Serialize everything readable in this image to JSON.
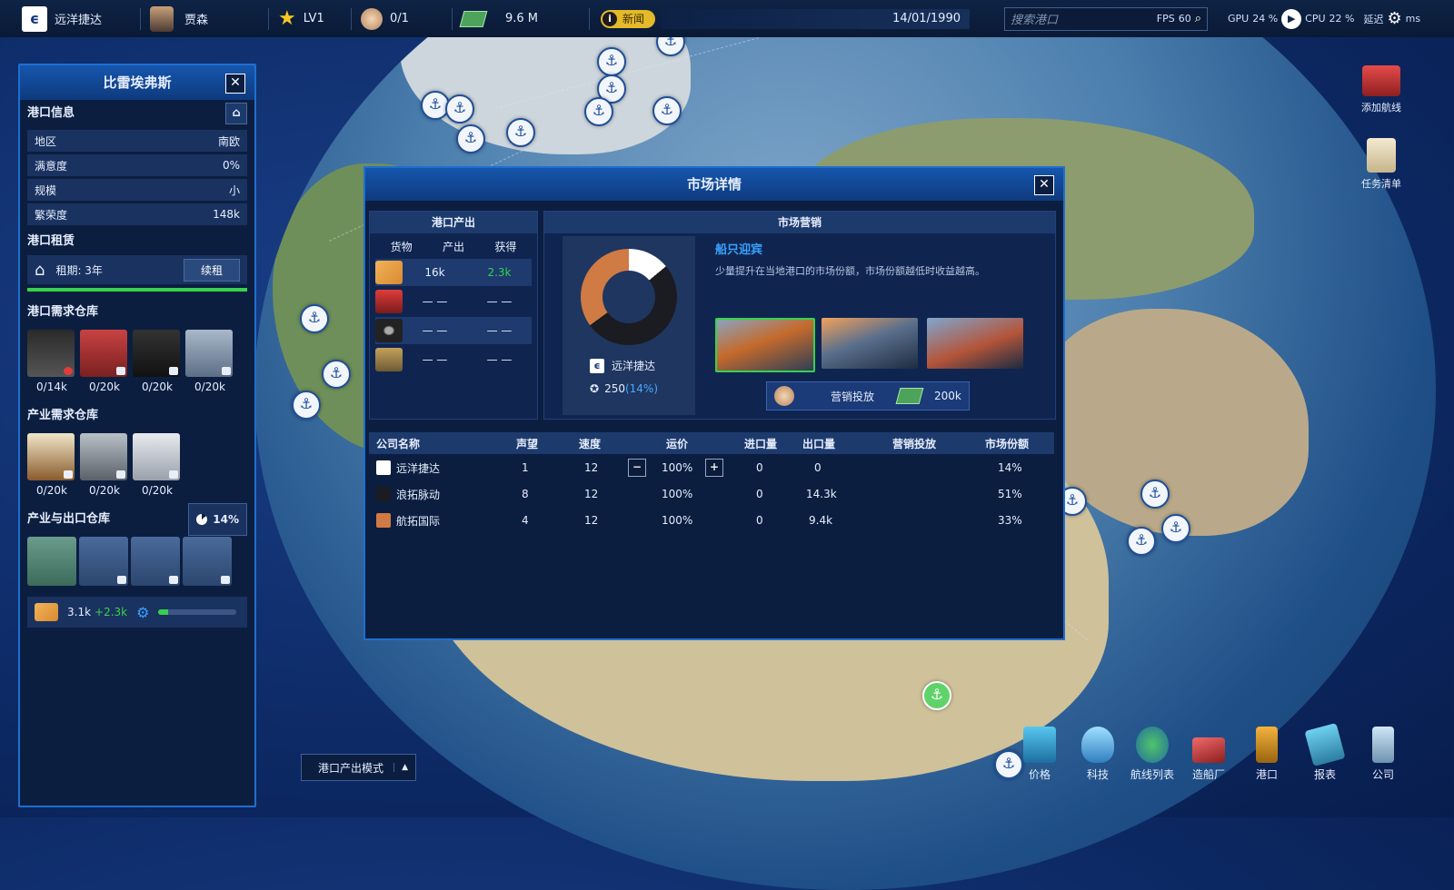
{
  "topbar": {
    "company": "远洋捷达",
    "ceo": "贾森",
    "level": "LV1",
    "staff": "0/1",
    "money": "9.6 M",
    "news": "新闻",
    "date": "14/01/1990",
    "search_placeholder": "搜索港口",
    "fps_label": "FPS",
    "fps_value": "60",
    "gpu_label": "GPU",
    "gpu_value": "24 %",
    "cpu_label": "CPU",
    "cpu_value": "22 %",
    "latency_label": "延迟",
    "latency_value": "ms"
  },
  "port_panel": {
    "title": "比雷埃弗斯",
    "info_title": "港口信息",
    "info": [
      {
        "label": "地区",
        "value": "南欧"
      },
      {
        "label": "满意度",
        "value": "0%"
      },
      {
        "label": "规模",
        "value": "小"
      },
      {
        "label": "繁荣度",
        "value": "148k"
      }
    ],
    "lease_title": "港口租赁",
    "lease_text": "租期: 3年",
    "renew_label": "续租",
    "demand_title": "港口需求仓库",
    "demand": [
      "0/14k",
      "0/20k",
      "0/20k",
      "0/20k"
    ],
    "industry_title": "产业需求仓库",
    "industry": [
      "0/20k",
      "0/20k",
      "0/20k"
    ],
    "output_title": "产业与出口仓库",
    "output_pct": "14%",
    "stock": "3.1k",
    "stock_gain": "+2.3k",
    "progress": 0.12
  },
  "market": {
    "title": "市场详情",
    "output_head": "港口产出",
    "col_goods": "货物",
    "col_output": "产出",
    "col_gain": "获得",
    "rows": [
      {
        "output": "16k",
        "gain": "2.3k"
      },
      {
        "output": "— —",
        "gain": "— —"
      },
      {
        "output": "— —",
        "gain": "— —"
      },
      {
        "output": "— —",
        "gain": "— —"
      }
    ],
    "marketing_head": "市场营销",
    "company_name": "远洋捷达",
    "score": "250",
    "score_pct": "(14%)",
    "campaign_title": "船只迎宾",
    "campaign_desc": "少量提升在当地港口的市场份额，市场份额越低时收益越高。",
    "invest_label": "营销投放",
    "invest_cost": "200k"
  },
  "table": {
    "headers": [
      "公司名称",
      "声望",
      "速度",
      "运价",
      "进口量",
      "出口量",
      "营销投放",
      "市场份额"
    ],
    "rows": [
      {
        "name": "远洋捷达",
        "rep": "1",
        "speed": "12",
        "price": "100%",
        "import": "0",
        "export": "0",
        "share": "14%",
        "color": "#ffffff"
      },
      {
        "name": "浪拓脉动",
        "rep": "8",
        "speed": "12",
        "price": "100%",
        "import": "0",
        "export": "14.3k",
        "share": "51%",
        "color": "#1b1b22"
      },
      {
        "name": "航拓国际",
        "rep": "4",
        "speed": "12",
        "price": "100%",
        "import": "0",
        "export": "9.4k",
        "share": "33%",
        "color": "#d07a44"
      }
    ]
  },
  "side": {
    "add_route": "添加航线",
    "tasks": "任务清单"
  },
  "bottom": {
    "mode": "港口产出模式",
    "items": [
      "价格",
      "科技",
      "航线列表",
      "造船厂",
      "港口",
      "报表",
      "公司"
    ]
  },
  "colors": {
    "accent": "#1e6fd0",
    "green": "#37d24b",
    "orange": "#d07a44"
  }
}
